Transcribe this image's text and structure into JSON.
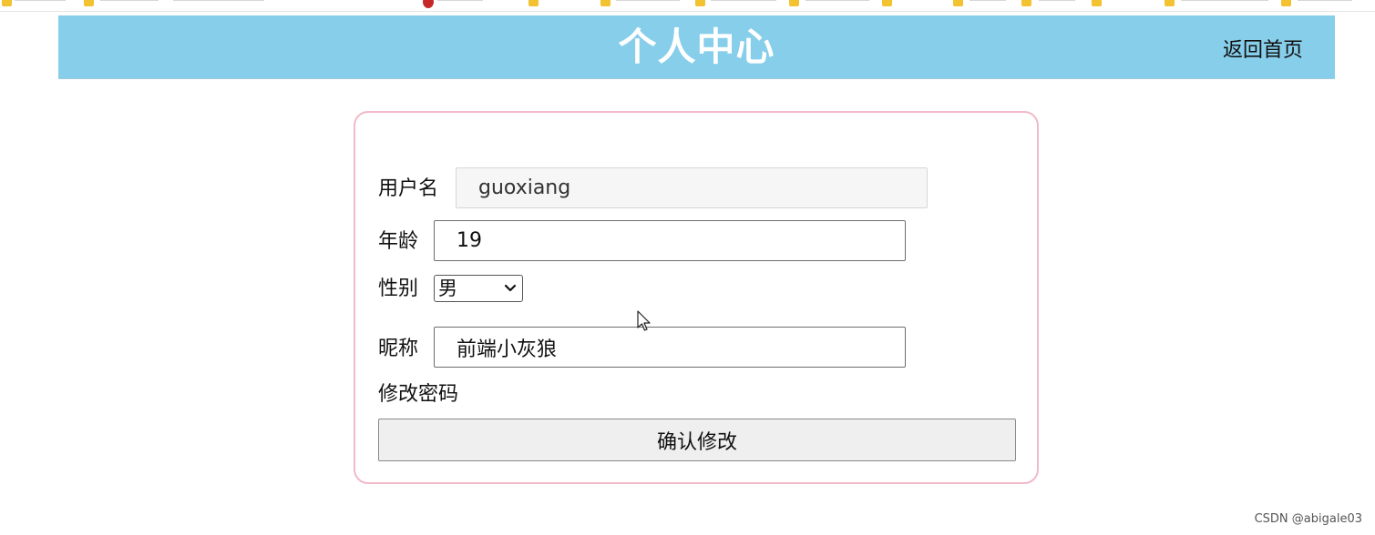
{
  "header": {
    "title": "个人中心",
    "home_link": "返回首页",
    "background_color": "#87ceeb",
    "title_color": "#ffffff"
  },
  "form": {
    "border_color": "#f2b9c8",
    "username_label": "用户名",
    "username_value": "guoxiang",
    "age_label": "年龄",
    "age_value": "19",
    "gender_label": "性别",
    "gender_value": "男",
    "nickname_label": "昵称",
    "nickname_value": "前端小灰狼",
    "change_password": "修改密码",
    "confirm_button": "确认修改"
  },
  "icons": {
    "gender_dropdown": "chevron-down-icon",
    "pointer": "mouse-cursor-icon"
  },
  "watermark": "CSDN @abigale03"
}
